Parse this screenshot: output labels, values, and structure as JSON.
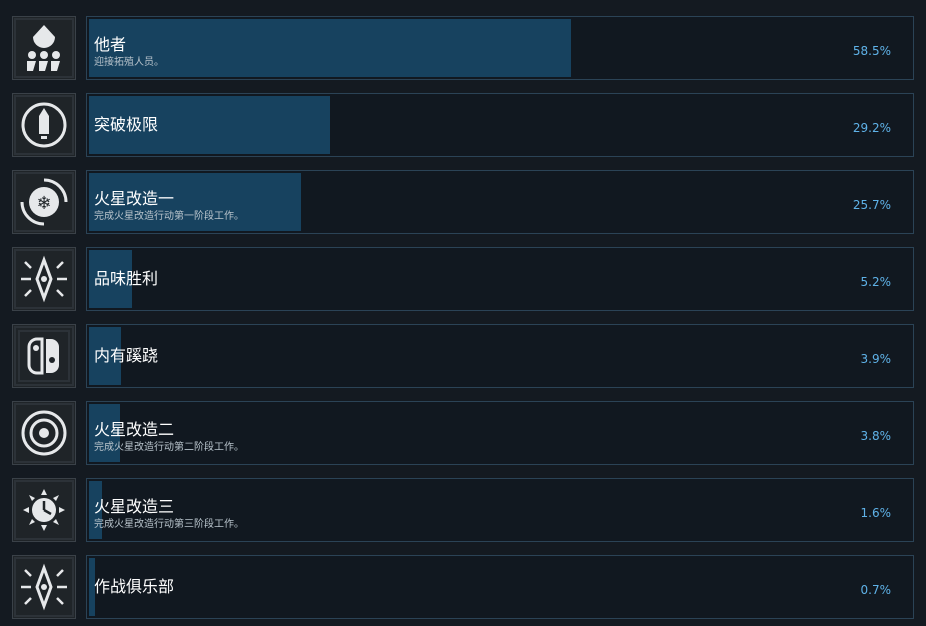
{
  "achievements": [
    {
      "title": "他者",
      "description": "迎接拓殖人员。",
      "percent_label": "58.5%",
      "fraction": 0.585,
      "icon": "colonists-icon"
    },
    {
      "title": "突破极限",
      "description": "",
      "percent_label": "29.2%",
      "fraction": 0.292,
      "icon": "rocket-icon"
    },
    {
      "title": "火星改造一",
      "description": "完成火星改造行动第一阶段工作。",
      "percent_label": "25.7%",
      "fraction": 0.257,
      "icon": "snowflake-icon"
    },
    {
      "title": "品味胜利",
      "description": "",
      "percent_label": "5.2%",
      "fraction": 0.052,
      "icon": "diamond-emblem-icon"
    },
    {
      "title": "内有蹊跷",
      "description": "",
      "percent_label": "3.9%",
      "fraction": 0.039,
      "icon": "switch-console-icon"
    },
    {
      "title": "火星改造二",
      "description": "完成火星改造行动第二阶段工作。",
      "percent_label": "3.8%",
      "fraction": 0.038,
      "icon": "target-rings-icon"
    },
    {
      "title": "火星改造三",
      "description": "完成火星改造行动第三阶段工作。",
      "percent_label": "1.6%",
      "fraction": 0.016,
      "icon": "sun-clock-icon"
    },
    {
      "title": "作战俱乐部",
      "description": "",
      "percent_label": "0.7%",
      "fraction": 0.007,
      "icon": "diamond-emblem-icon"
    }
  ],
  "colors": {
    "bar_fill": "#17425f",
    "percent_text": "#5fb2e8",
    "panel_border": "#2b4356"
  }
}
